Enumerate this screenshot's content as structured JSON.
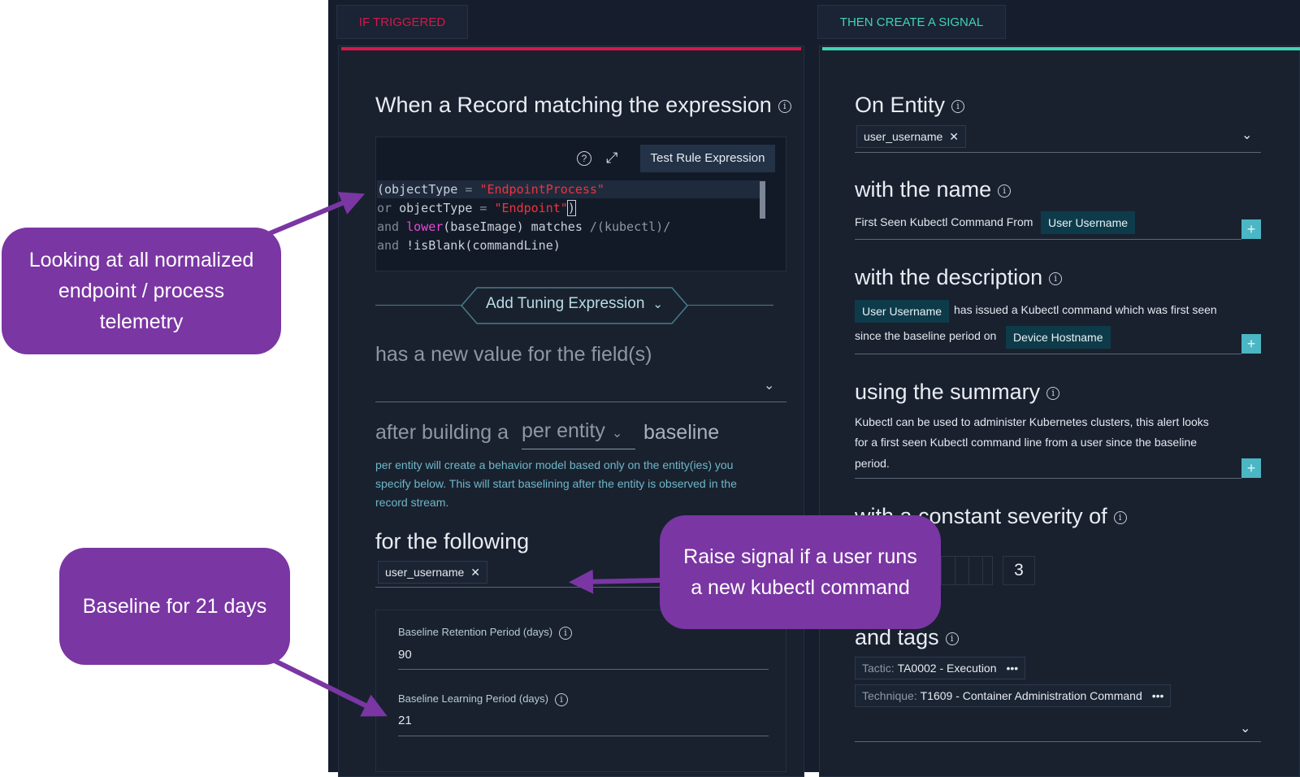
{
  "tabs": {
    "trigger": "IF TRIGGERED",
    "signal": "THEN CREATE A SIGNAL"
  },
  "left": {
    "expr_heading": "When a Record matching the expression",
    "test_button": "Test Rule Expression",
    "code_lines": [
      {
        "pre": "(objectType",
        "op": " = ",
        "str": "\"EndpointProcess\"",
        "post": ""
      },
      {
        "kw": "or ",
        "pre": "objectType",
        "op": " = ",
        "str": "\"Endpoint\"",
        "post": ")"
      },
      {
        "kw": "and ",
        "fn": "lower",
        "pre": "(baseImage) matches ",
        "op": "/(kubectl)/",
        "str": "",
        "post": ""
      },
      {
        "kw": "and ",
        "pre": "!isBlank(commandLine)",
        "op": "",
        "str": "",
        "post": ""
      }
    ],
    "add_tuning": "Add Tuning Expression",
    "new_value_heading": "has a new value for the field(s)",
    "after_building": "after building a",
    "per_entity": "per entity",
    "baseline": "baseline",
    "baseline_desc": [
      "per entity will create a behavior model based only on the entity(ies) you",
      "specify below. This will start baselining after the entity is observed in the",
      "record stream."
    ],
    "for_following": "for the following",
    "for_following_chip": "user_username",
    "retention_label": "Baseline Retention Period (days)",
    "retention_value": "90",
    "learning_label": "Baseline Learning Period (days)",
    "learning_value": "21"
  },
  "right": {
    "on_entity": "On Entity",
    "entity_chip": "user_username",
    "with_name": "with the name",
    "name_text": "First Seen Kubectl Command From",
    "name_token": "User Username",
    "with_description": "with the description",
    "desc_token1": "User Username",
    "desc_text1": "has issued a Kubectl command which was first seen",
    "desc_text2": "since the baseline period on",
    "desc_token2": "Device Hostname",
    "using_summary": "using the summary",
    "summary_lines": [
      "Kubectl can be used to administer Kubernetes clusters, this alert looks",
      "for a first seen Kubectl command line from a user since the baseline",
      "period."
    ],
    "severity_heading": "with a constant severity of",
    "severity_value": "3",
    "and_tags": "and tags",
    "tag1_key": "Tactic",
    "tag1_value": "TA0002 - Execution",
    "tag2_key": "Technique",
    "tag2_value": "T1609 - Container Administration Command"
  },
  "callouts": {
    "telemetry": "Looking at all normalized endpoint / process telemetry",
    "raise": "Raise signal if a user runs a new kubectl command",
    "baseline": "Baseline for 21 days"
  },
  "colors": {
    "trigger_accent": "#d7174a",
    "signal_accent": "#3fd3b6",
    "callout": "#7a36a3"
  }
}
